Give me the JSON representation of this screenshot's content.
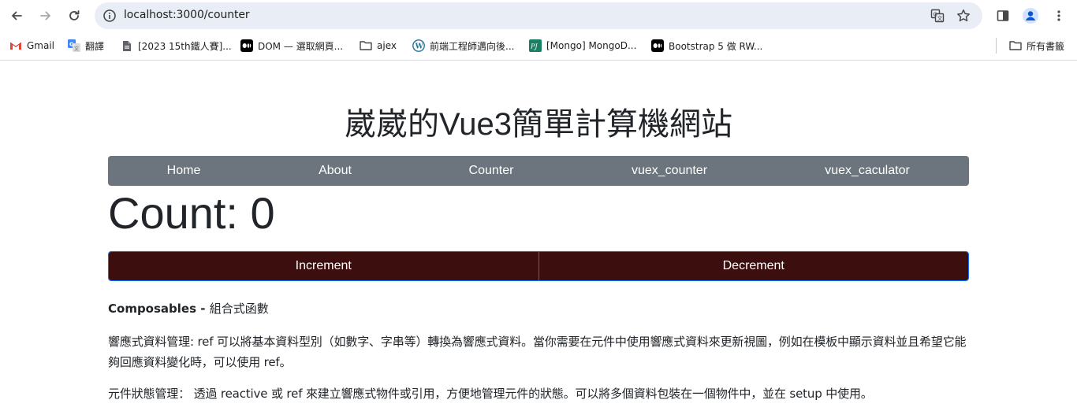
{
  "browser": {
    "url": "localhost:3000/counter",
    "bookmarks": [
      {
        "label": "Gmail",
        "icon": "gmail-icon"
      },
      {
        "label": "翻譯",
        "icon": "google-translate-icon"
      },
      {
        "label": "[2023 15th鐵人賽]...",
        "icon": "document-icon"
      },
      {
        "label": "DOM — 選取網頁...",
        "icon": "medium-icon"
      },
      {
        "label": "ajex",
        "icon": "folder-icon"
      },
      {
        "label": "前端工程師邁向後...",
        "icon": "wordpress-icon"
      },
      {
        "label": "[Mongo] MongoD...",
        "icon": "pj-icon"
      },
      {
        "label": "Bootstrap 5 做 RW...",
        "icon": "medium-icon"
      }
    ],
    "all_bookmarks": "所有書籤"
  },
  "page": {
    "title": "崴崴的Vue3簡單計算機網站",
    "nav": [
      "Home",
      "About",
      "Counter",
      "vuex_counter",
      "vuex_caculator"
    ],
    "count_label": "Count: 0",
    "increment": "Increment",
    "decrement": "Decrement",
    "heading_bold": "Composables - ",
    "heading_rest": "組合式函數",
    "paragraph1": "響應式資料管理: ref 可以將基本資料型別（如數字、字串等）轉換為響應式資料。當你需要在元件中使用響應式資料來更新視圖，例如在模板中顯示資料並且希望它能夠回應資料變化時，可以使用 ref。",
    "paragraph2": "元件狀態管理： 透過 reactive 或 ref 來建立響應式物件或引用，方便地管理元件的狀態。可以將多個資料包裝在一個物件中，並在 setup 中使用。"
  },
  "colors": {
    "navbar": "#6c757d",
    "button": "#3d0e0e",
    "button_border": "#0d6efd"
  }
}
